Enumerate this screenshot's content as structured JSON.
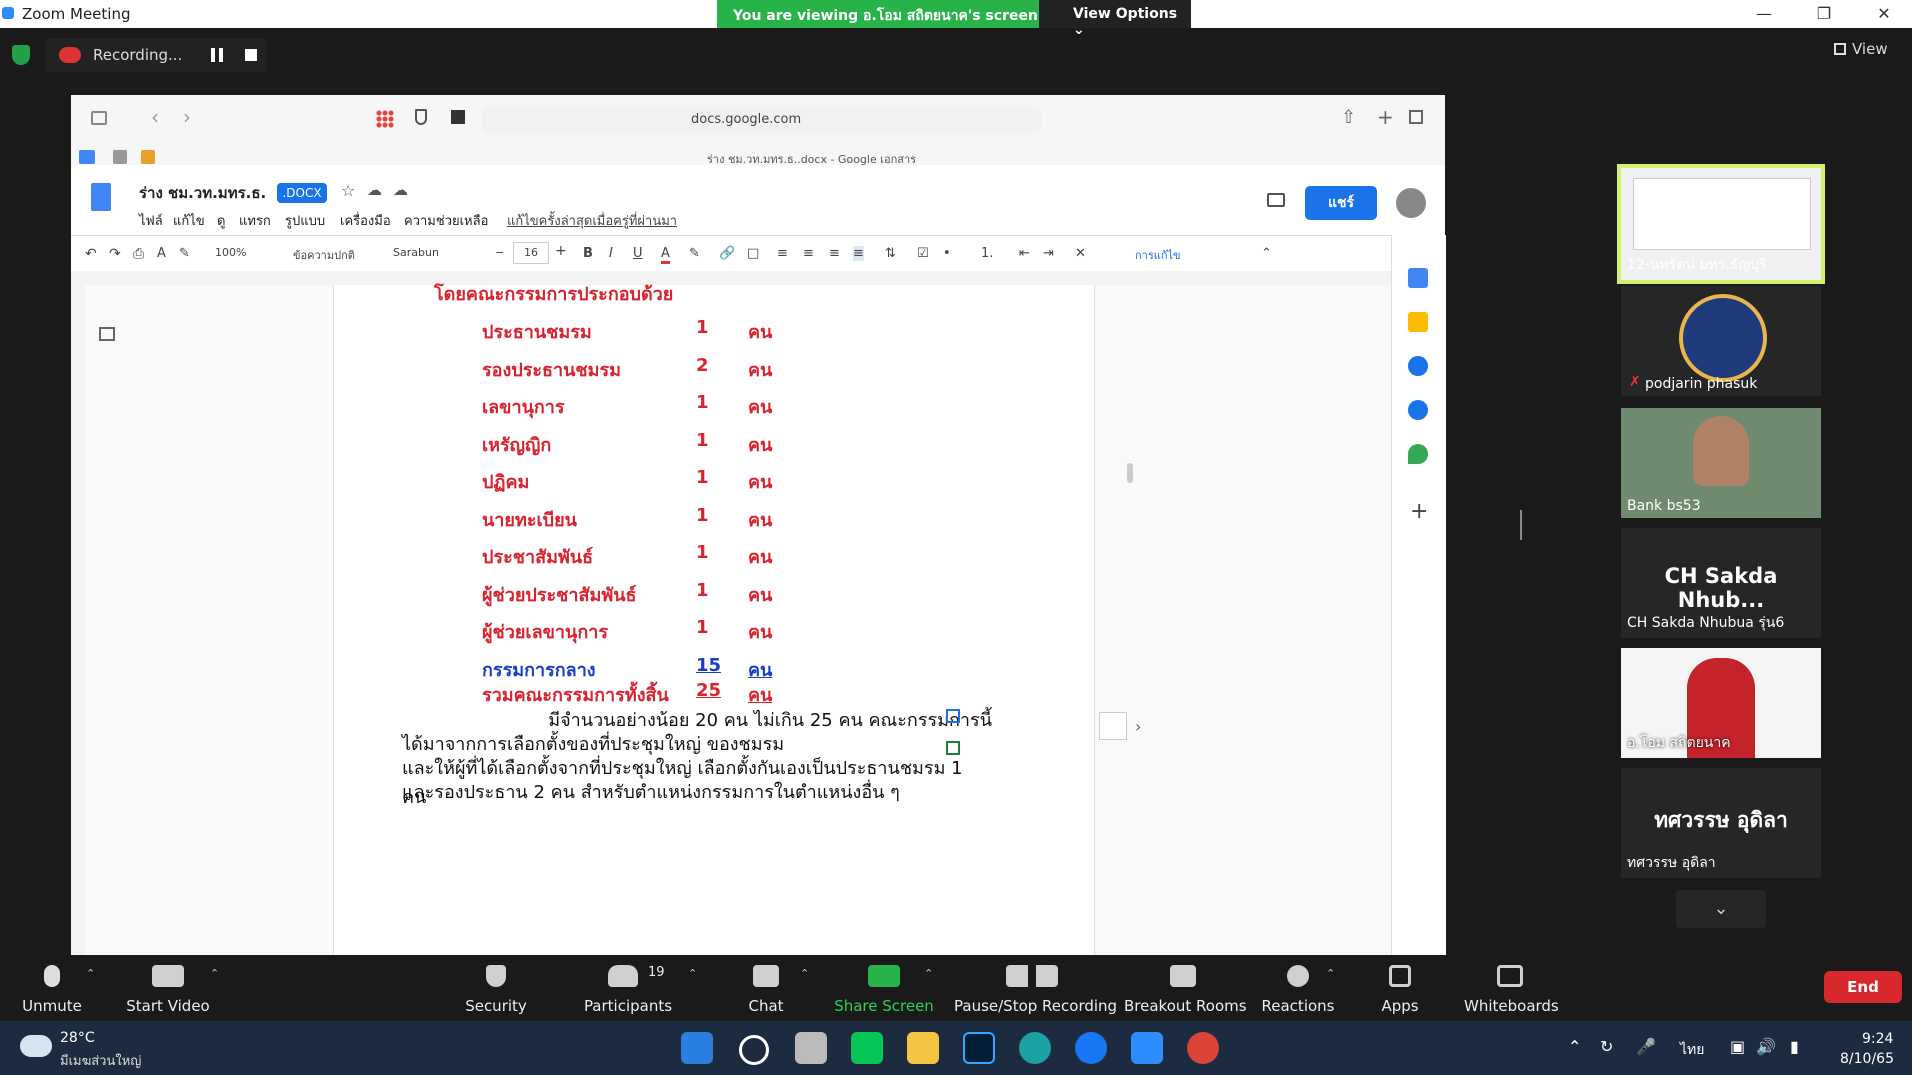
{
  "window": {
    "title": "Zoom Meeting",
    "share_banner": "You are viewing อ.โอม สถิตยนาค's screen",
    "view_options": "View Options ⌄",
    "recording_label": "Recording...",
    "view_label": "View"
  },
  "browser": {
    "url": "docs.google.com",
    "tab_title": "ร่าง ชม.วท.มทร.ธ..docx - Google เอกสาร"
  },
  "doc": {
    "title": "ร่าง ชม.วท.มทร.ธ.",
    "badge": ".DOCX",
    "menu": [
      "ไฟล์",
      "แก้ไข",
      "ดู",
      "แทรก",
      "รูปแบบ",
      "เครื่องมือ",
      "ความช่วยเหลือ"
    ],
    "last_edit": "แก้ไขครั้งล่าสุดเมื่อครู่ที่ผ่านมา",
    "share": "แชร์",
    "toolbar": {
      "zoom": "100%",
      "style": "ข้อความปกติ",
      "font": "Sarabun",
      "size": "16",
      "editing": "การแก้ไข"
    },
    "heading": "โดยคณะกรรมการประกอบด้วย",
    "roles": [
      {
        "role": "ประธานชมรม",
        "count": "1",
        "unit": "คน"
      },
      {
        "role": "รองประธานชมรม",
        "count": "2",
        "unit": "คน"
      },
      {
        "role": "เลขานุการ",
        "count": "1",
        "unit": "คน"
      },
      {
        "role": "เหรัญญิก",
        "count": "1",
        "unit": "คน"
      },
      {
        "role": "ปฏิคม",
        "count": "1",
        "unit": "คน"
      },
      {
        "role": "นายทะเบียน",
        "count": "1",
        "unit": "คน"
      },
      {
        "role": "ประชาสัมพันธ์",
        "count": "1",
        "unit": "คน"
      },
      {
        "role": "ผู้ช่วยประชาสัมพันธ์",
        "count": "1",
        "unit": "คน"
      },
      {
        "role": "ผู้ช่วยเลขานุการ",
        "count": "1",
        "unit": "คน"
      }
    ],
    "central": {
      "role": "กรรมการกลาง",
      "count": "15",
      "unit": "คน"
    },
    "total": {
      "role": "รวมคณะกรรมการทั้งสิ้น",
      "count": "25",
      "unit": "คน"
    },
    "paragraph": [
      "มีจำนวนอย่างน้อย 20 คน ไม่เกิน 25 คน คณะกรรมการนี้",
      "ได้มาจากการเลือกตั้งของที่ประชุมใหญ่ ของชมรม",
      "และให้ผู้ที่ได้เลือกตั้งจากที่ประชุมใหญ่ เลือกตั้งกันเองเป็นประธานชมรม 1 คน",
      "และรองประธาน 2 คน สำหรับตำแหน่งกรรมการในตำแหน่งอื่น ๆ"
    ]
  },
  "participants": [
    {
      "name": "12-นพรัตน์ มทร.ธัญบุรี",
      "type": "video"
    },
    {
      "name": "podjarin phasuk",
      "type": "avatar"
    },
    {
      "name": "Bank bs53",
      "type": "video"
    },
    {
      "name": "CH Sakda Nhubua รุ่น6",
      "big": "CH Sakda Nhub...",
      "type": "name"
    },
    {
      "name": "อ.โอม สถิตยนาค",
      "type": "video"
    },
    {
      "name": "ทศวรรษ อุดิลา",
      "big": "ทศวรรษ อุดิลา",
      "type": "name"
    }
  ],
  "controls": {
    "unmute": "Unmute",
    "start_video": "Start Video",
    "security": "Security",
    "participants": "Participants",
    "participants_count": "19",
    "chat": "Chat",
    "share_screen": "Share Screen",
    "pause_stop": "Pause/Stop Recording",
    "breakout": "Breakout Rooms",
    "reactions": "Reactions",
    "apps": "Apps",
    "whiteboards": "Whiteboards",
    "end": "End"
  },
  "taskbar": {
    "temp": "28°C",
    "condition": "มีเมฆส่วนใหญ่",
    "lang": "ไทย",
    "time": "9:24",
    "date": "8/10/65"
  },
  "colors": {
    "zoom_green": "#27b24a",
    "zoom_red": "#d9272e",
    "docs_blue": "#1a73e8",
    "doc_red_text": "#d9242f",
    "doc_blue_text": "#1a3fc7"
  }
}
